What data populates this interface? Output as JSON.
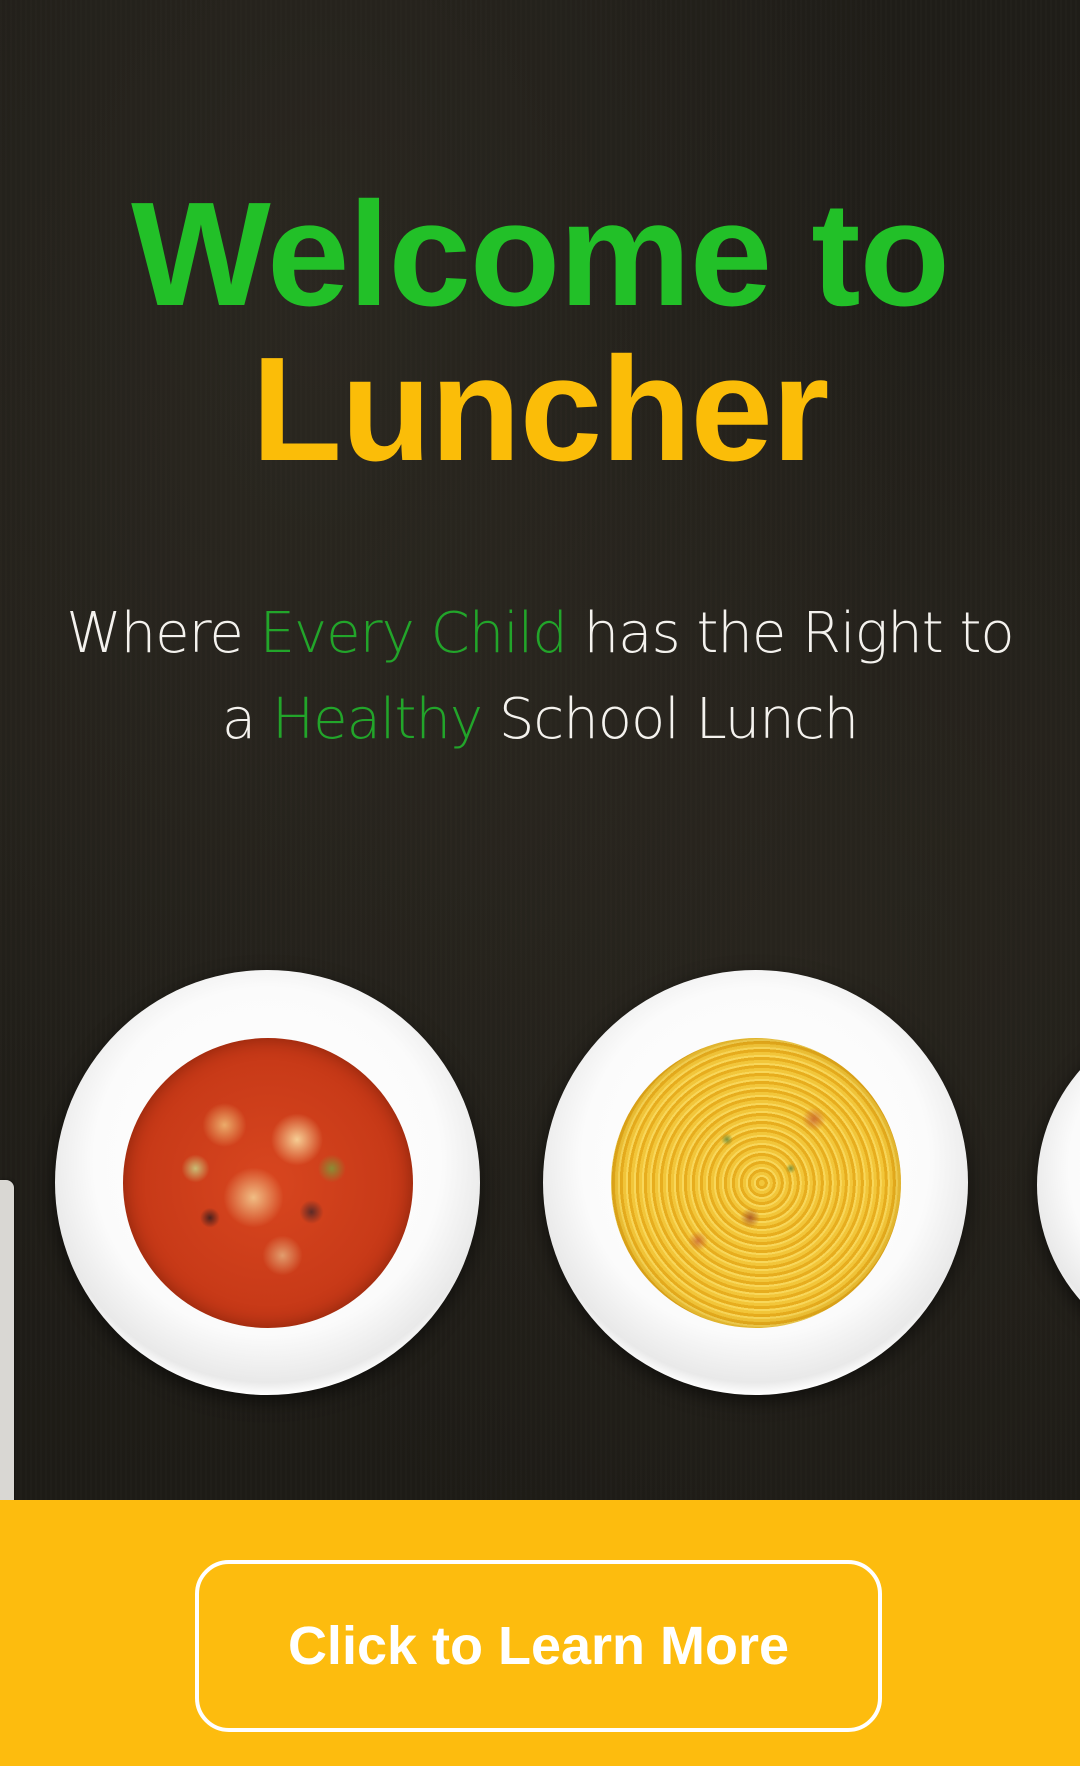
{
  "hero": {
    "title_line1": "Welcome to",
    "title_line2": "Luncher",
    "tagline": {
      "part1": "Where ",
      "highlight1": "Every Child",
      "part2": " has the Right to a ",
      "highlight2": "Healthy",
      "part3": " School Lunch"
    }
  },
  "dishes": [
    {
      "name": "soup"
    },
    {
      "name": "spaghetti"
    },
    {
      "name": "partial-dish"
    }
  ],
  "footer": {
    "cta_label": "Click to Learn More"
  },
  "colors": {
    "title_green": "#22c028",
    "title_yellow": "#fbbd08",
    "accent_yellow": "#fdbc0e",
    "highlight_green": "#22a52a",
    "background": "#1f1d18"
  }
}
